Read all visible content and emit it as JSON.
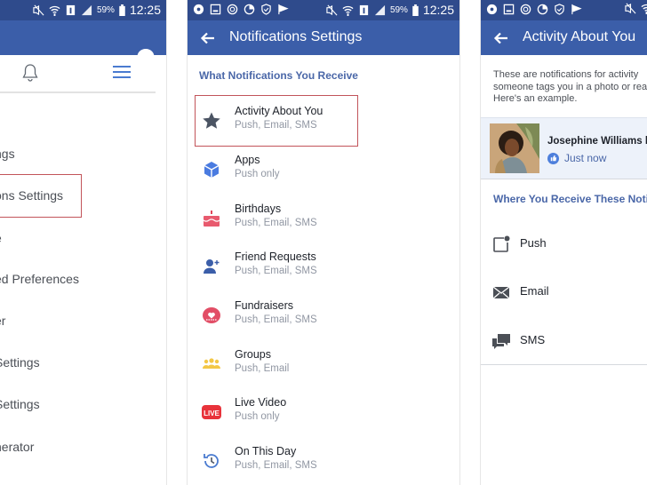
{
  "status_bar": {
    "battery": "59%",
    "time": "12:25",
    "left_icons": [
      "app-notification-icon",
      "gallery-icon",
      "sync-icon",
      "data-usage-icon",
      "shield-icon",
      "flag-icon"
    ],
    "right_icons": [
      "mute-icon",
      "wifi-icon",
      "sim-icon",
      "signal-icon",
      "battery-icon"
    ]
  },
  "panel1": {
    "header_icons": [
      "messenger-icon"
    ],
    "tabs": [
      "notifications-bell-icon",
      "menu-icon"
    ],
    "menu_items": [
      {
        "label": "ngs"
      },
      {
        "label": "ons Settings",
        "highlighted": true
      },
      {
        "label": "e"
      },
      {
        "label": "ed Preferences"
      },
      {
        "label": "er"
      },
      {
        "label": "Settings"
      },
      {
        "label": "Settings"
      },
      {
        "label": "nerator"
      }
    ]
  },
  "panel2": {
    "title": "Notifications Settings",
    "section_title": "What Notifications You Receive",
    "items": [
      {
        "name": "Activity About You",
        "sub": "Push, Email, SMS",
        "icon": "star-icon",
        "highlighted": true
      },
      {
        "name": "Apps",
        "sub": "Push only",
        "icon": "cube-icon"
      },
      {
        "name": "Birthdays",
        "sub": "Push, Email, SMS",
        "icon": "cake-icon"
      },
      {
        "name": "Friend Requests",
        "sub": "Push, Email, SMS",
        "icon": "add-friend-icon"
      },
      {
        "name": "Fundraisers",
        "sub": "Push, Email, SMS",
        "icon": "fundraiser-heart-icon"
      },
      {
        "name": "Groups",
        "sub": "Push, Email",
        "icon": "groups-icon"
      },
      {
        "name": "Live Video",
        "sub": "Push only",
        "icon": "live-video-icon",
        "icon_text": "LIVE"
      },
      {
        "name": "On This Day",
        "sub": "Push, Email, SMS",
        "icon": "history-clock-icon"
      }
    ]
  },
  "panel3": {
    "title": "Activity About You",
    "description_lines": [
      "These are notifications for activity",
      "someone tags you in a photo or rea",
      "Here's an example."
    ],
    "example": {
      "name": "Josephine Williams li",
      "time": "Just now"
    },
    "section_title": "Where You Receive These Notific",
    "channels": [
      {
        "label": "Push",
        "icon": "push-notification-icon"
      },
      {
        "label": "Email",
        "icon": "email-icon"
      },
      {
        "label": "SMS",
        "icon": "sms-icon"
      }
    ]
  },
  "colors": {
    "status_bar": "#2f4b8c",
    "app_bar": "#3b5ea9",
    "section_title": "#4a67a8",
    "highlight_box": "#c2545a"
  }
}
